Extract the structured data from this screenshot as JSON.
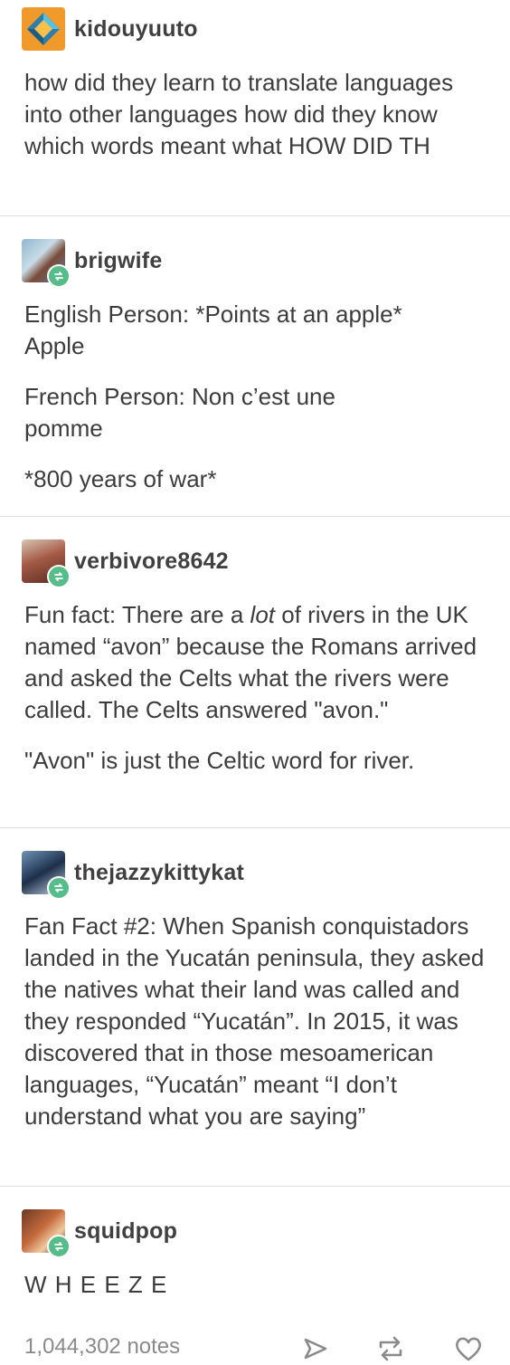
{
  "posts": [
    {
      "username": "kidouyuuto",
      "avatar_icon": "diamond-logo-icon",
      "paragraphs": [
        "how did they learn to translate languages into other languages how did they know which words meant what HOW DID TH"
      ]
    },
    {
      "username": "brigwife",
      "avatar_icon": "reblog-icon",
      "paragraphs": [
        "English Person: *Points at an apple* Apple",
        "French Person: Non c’est une pomme",
        "*800 years of war*"
      ]
    },
    {
      "username": "verbivore8642",
      "avatar_icon": "reblog-icon",
      "paragraphs_rich": [
        [
          "Fun fact: There are a ",
          "lot",
          " of rivers in the UK named “avon” because the Romans arrived and asked the Celts what the rivers were called. The Celts answered \"avon.\""
        ]
      ],
      "paragraphs": [
        "\"Avon\" is just the Celtic word for river."
      ]
    },
    {
      "username": "thejazzykittykat",
      "avatar_icon": "reblog-icon",
      "paragraphs": [
        "Fan Fact #2: When Spanish conquistadors landed in the Yucatán peninsula, they asked the natives what their land was called and they responded “Yucatán”. In 2015, it was discovered that in those mesoamerican languages, “Yucatán” meant “I don’t understand what you are saying”"
      ]
    },
    {
      "username": "squidpop",
      "avatar_icon": "reblog-icon",
      "paragraphs": [
        "W H E E Z E"
      ]
    }
  ],
  "footer": {
    "notes": "1,044,302 notes",
    "share_icon": "share-icon",
    "reblog_icon": "reblog-icon",
    "like_icon": "heart-icon"
  },
  "colors": {
    "reblog_green": "#56bc8a",
    "text": "#3c3c3c",
    "muted": "#8a8a8a",
    "divider": "#dcdcdc"
  }
}
